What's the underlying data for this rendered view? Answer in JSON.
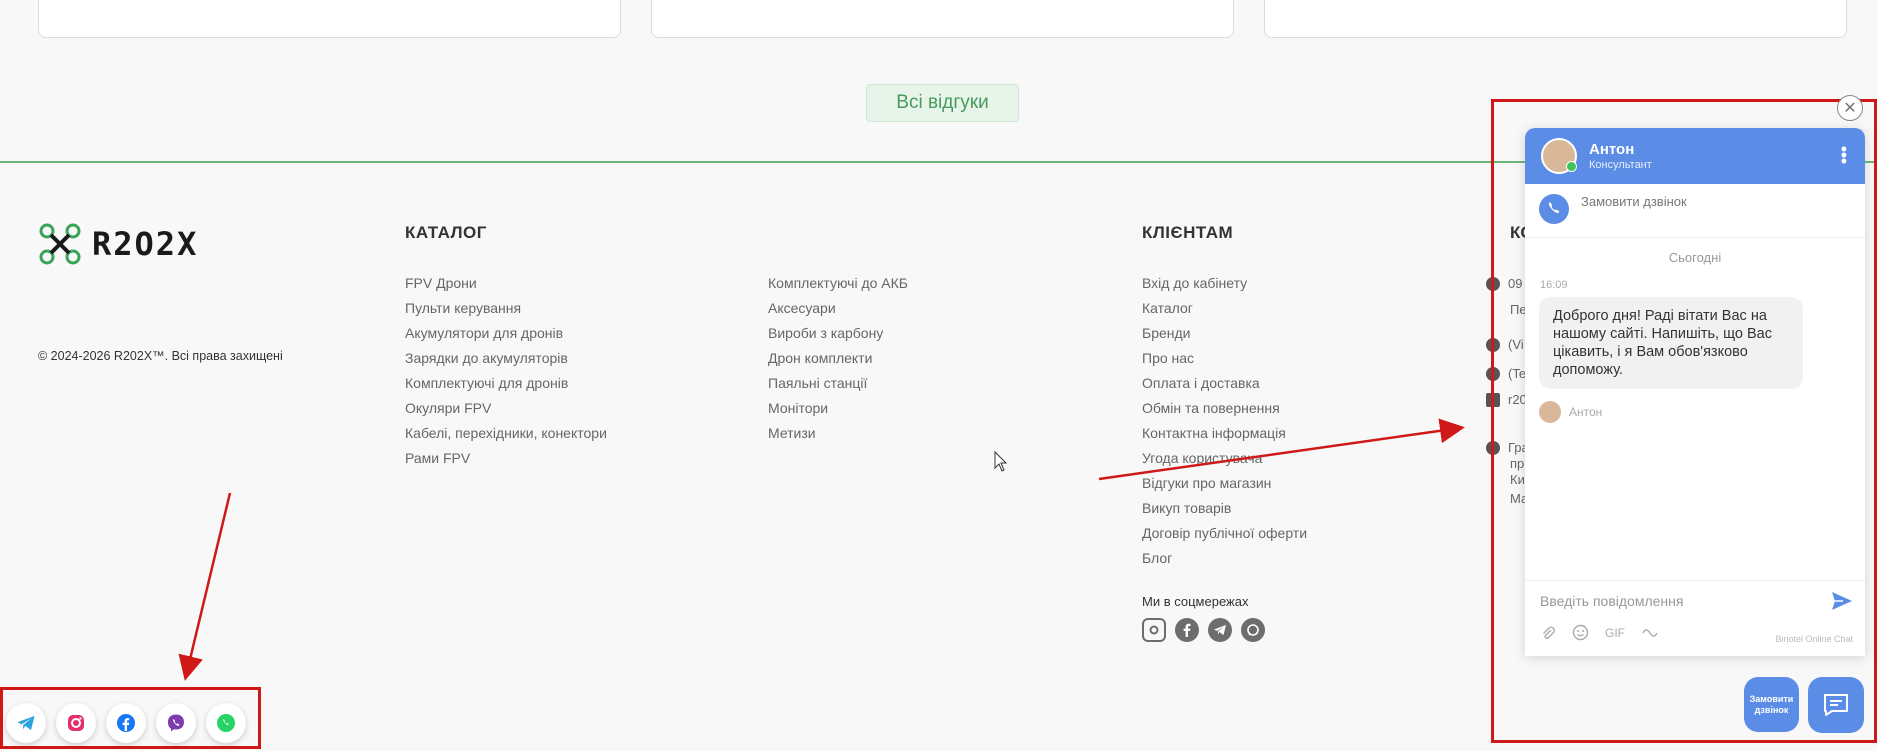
{
  "reviews": {
    "all_label": "Всі відгуки"
  },
  "logo": {
    "text": "R2O2X"
  },
  "copyright": "© 2024-2026 R202X™. Всі права захищені",
  "catalog": {
    "title": "КАТАЛОГ",
    "col1": [
      "FPV Дрони",
      "Пульти керування",
      "Акумулятори для дронів",
      "Зарядки до акумуляторів",
      "Комплектуючі для дронів",
      "Окуляри FPV",
      "Кабелі, перехідники, конектори",
      "Рами FPV"
    ],
    "col2": [
      "Комплектуючі до АКБ",
      "Аксесуари",
      "Вироби з карбону",
      "Дрон комплекти",
      "Паяльні станції",
      "Монітори",
      "Метизи"
    ]
  },
  "clients": {
    "title": "КЛІЄНТАМ",
    "items": [
      "Вхід до кабінету",
      "Каталог",
      "Бренди",
      "Про нас",
      "Оплата і доставка",
      "Обмін та повернення",
      "Контактна інформація",
      "Угода користувача",
      "Відгуки про магазин",
      "Викуп товарів",
      "Договір публічної оферти",
      "Блог"
    ]
  },
  "social": {
    "title": "Ми в соцмережах",
    "icons": [
      "instagram-icon",
      "facebook-icon",
      "telegram-icon",
      "whatsapp-icon"
    ]
  },
  "contacts": {
    "title": "КО",
    "rows": [
      "09",
      "Пе",
      "(Vi",
      "(Te",
      "r20",
      "Гра",
      "пр",
      "Ки",
      "Ма"
    ]
  },
  "floating_social": [
    "telegram-icon",
    "instagram-icon",
    "facebook-icon",
    "viber-icon",
    "whatsapp-icon"
  ],
  "chat": {
    "agent_name": "Антон",
    "agent_role": "Консультант",
    "call_label": "Замовити дзвінок",
    "day_label": "Сьогодні",
    "time": "16:09",
    "message": "Доброго дня! Раді вітати Вас на нашому сайті. Напишіть, що Вас цікавить, і я Вам обов'язково допоможу.",
    "signature": "Антон",
    "input_placeholder": "Введіть повідомлення",
    "gif_label": "GIF",
    "brand": "Binotel Online Chat",
    "order_call_button": "Замовити дзвінок"
  },
  "colors": {
    "accent": "#5b8de6",
    "green": "#6ab77a",
    "annotation": "#d01818"
  }
}
